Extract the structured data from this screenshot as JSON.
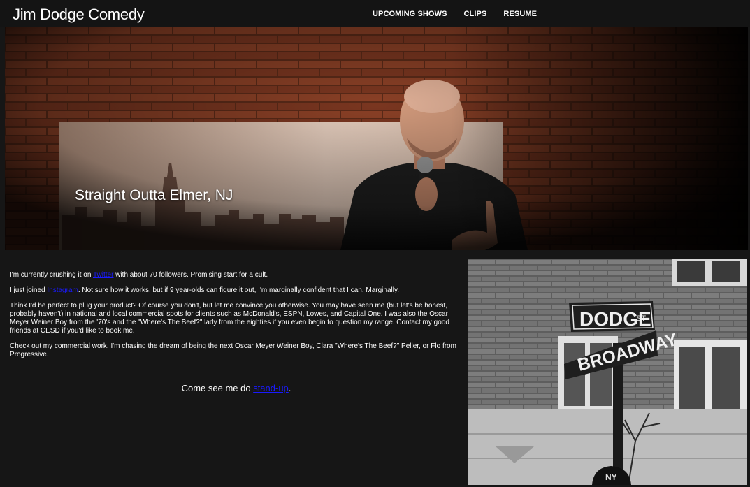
{
  "nav": {
    "brand": "Jim Dodge Comedy",
    "links": [
      "UPCOMING SHOWS",
      "CLIPS",
      "RESUME"
    ]
  },
  "hero": {
    "tagline": "Straight Outta Elmer, NJ"
  },
  "content": {
    "p1": {
      "before": "I'm currently crushing it on ",
      "link": "Twitter",
      "after": " with about 70 followers. Promising start for a cult."
    },
    "p2": {
      "before": "I just joined ",
      "link": "Instagram",
      "after": ". Not sure how it works, but if 9 year-olds can figure it out, I'm marginally confident that I can. Marginally."
    },
    "p3": "Think I'd be perfect to plug your product? Of course you don't, but let me convince you otherwise. You may have seen me (but let's be honest, probably haven't) in national and local commercial spots for clients such as McDonald's, ESPN, Lowes, and Capital One. I was also the Oscar Meyer Weiner Boy from the '70's and the \"Where's The Beef?\" lady from the eighties if you even begin to question my range. Contact my good friends at CESD if you'd like to book me.",
    "p4": "Check out my commercial work. I'm chasing the dream of being the next Oscar Meyer Weiner Boy, Clara \"Where's The Beef?\" Peller, or Flo from Progressive."
  },
  "cta": {
    "before": "Come see me do ",
    "link": "stand-up",
    "after": "."
  },
  "photo": {
    "sign_top": "DODGE",
    "sign_top_suffix": "ST",
    "sign_bottom": "BROADWAY",
    "cap_logo": "NY"
  },
  "colors": {
    "background": "#161616",
    "link": "#1a1aff"
  }
}
